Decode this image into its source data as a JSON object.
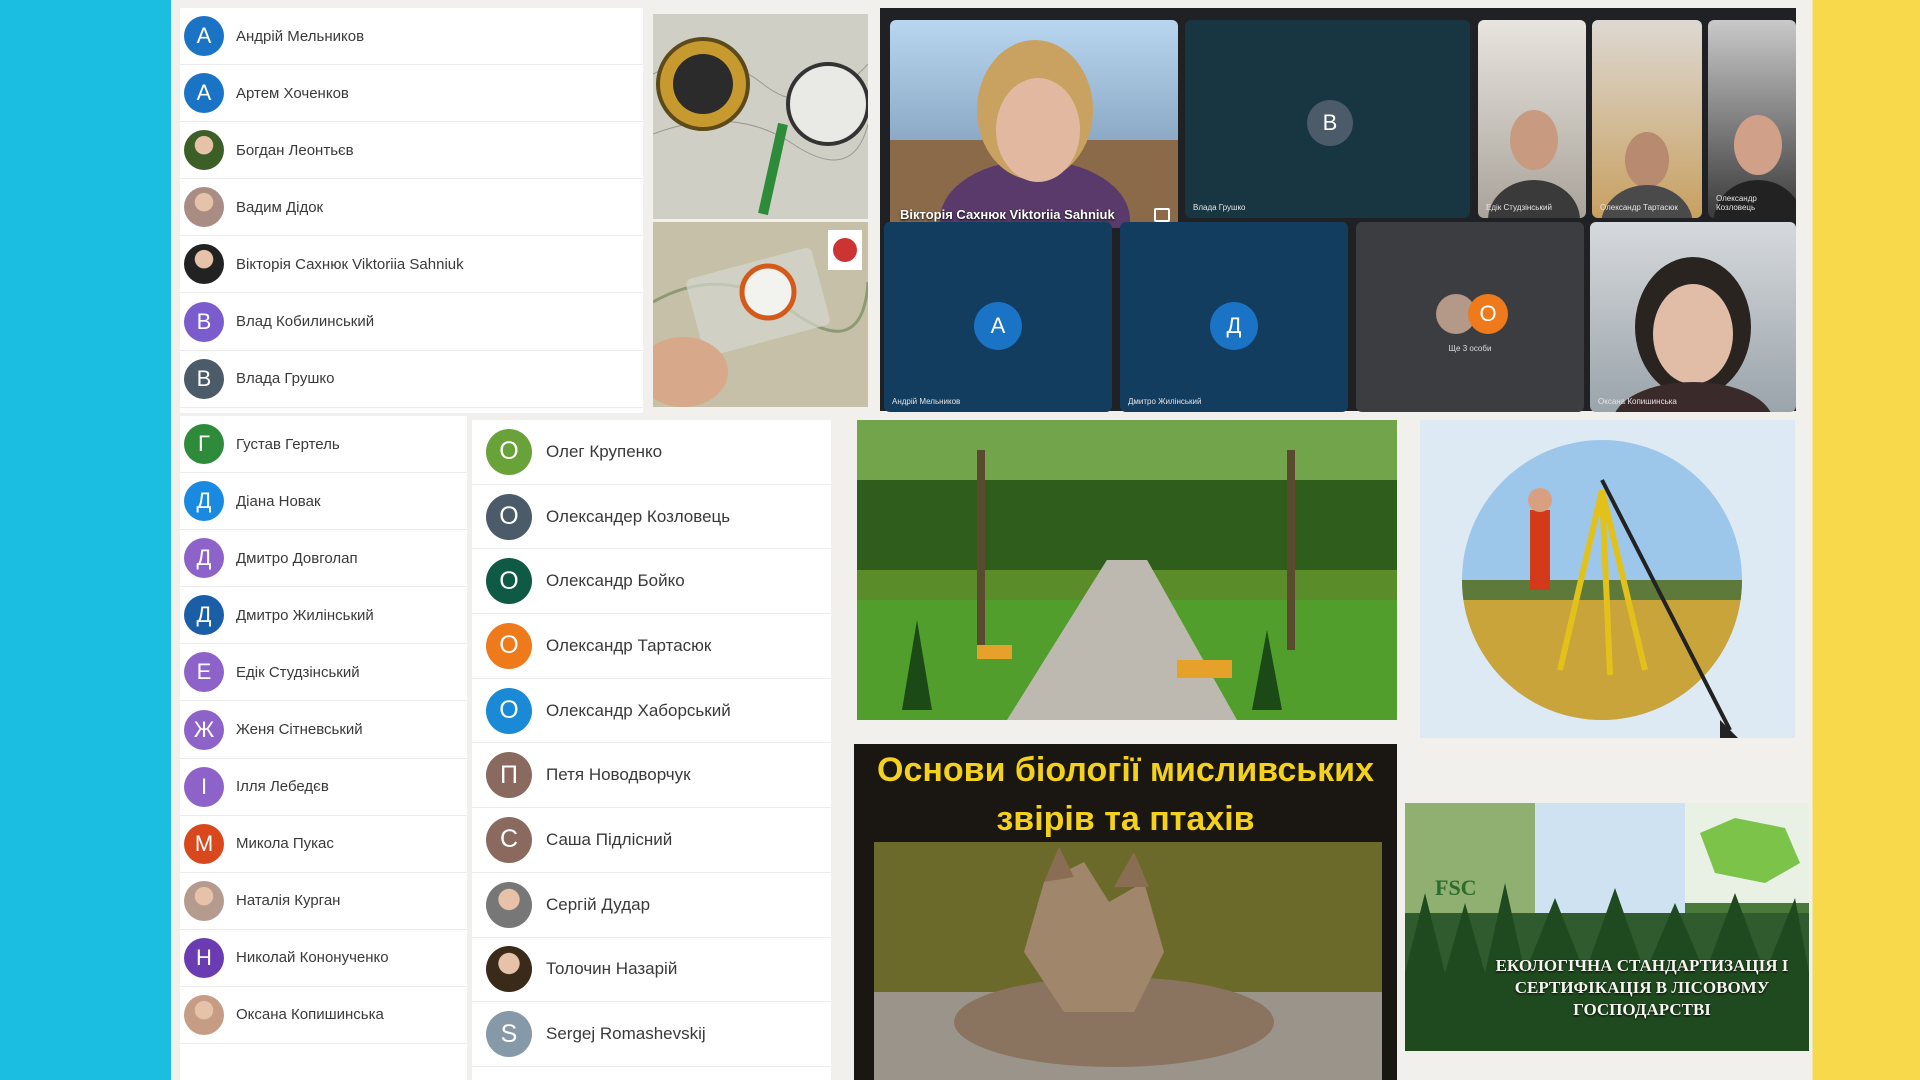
{
  "list_a": [
    {
      "name": "Андрій Мельников",
      "initial": "А",
      "color": "#1a73c4"
    },
    {
      "name": "Артем Хоченков",
      "initial": "А",
      "color": "#1a73c4"
    },
    {
      "name": "Богдан Леонтьєв",
      "initial": "",
      "color": "#3b5f26",
      "photo": true
    },
    {
      "name": "Вадим Дідок",
      "initial": "",
      "color": "#a98c83",
      "photo": true
    },
    {
      "name": "Вікторія Сахнюк Viktoriia Sahniuk",
      "initial": "",
      "color": "#222",
      "photo": true
    },
    {
      "name": "Влад Кобилинський",
      "initial": "В",
      "color": "#7a5ccc"
    },
    {
      "name": "Влада Грушко",
      "initial": "В",
      "color": "#4b5b6a"
    }
  ],
  "list_b": [
    {
      "name": "Густав Гертель",
      "initial": "Г",
      "color": "#2e8b3a"
    },
    {
      "name": "Діана Новак",
      "initial": "Д",
      "color": "#1a8ae0"
    },
    {
      "name": "Дмитро Довголап",
      "initial": "Д",
      "color": "#8e63c9"
    },
    {
      "name": "Дмитро Жилінський",
      "initial": "Д",
      "color": "#1a5ea8"
    },
    {
      "name": "Едік Студзінський",
      "initial": "Е",
      "color": "#8e63c9"
    },
    {
      "name": "Женя Сітневський",
      "initial": "Ж",
      "color": "#8e63c9"
    },
    {
      "name": "Ілля Лебедєв",
      "initial": "І",
      "color": "#8e63c9"
    },
    {
      "name": "Микола Пукас",
      "initial": "М",
      "color": "#d9481c"
    },
    {
      "name": "Наталія Курган",
      "initial": "",
      "color": "#b59a8e",
      "photo": true
    },
    {
      "name": "Николай Кононученко",
      "initial": "Н",
      "color": "#6b3bb2"
    },
    {
      "name": "Оксана Копишинська",
      "initial": "",
      "color": "#c69c84",
      "photo": true
    }
  ],
  "list_c": [
    {
      "name": "Олег Крупенко",
      "initial": "О",
      "color": "#6aa23a"
    },
    {
      "name": "Олександер Козловець",
      "initial": "О",
      "color": "#4b5b6a"
    },
    {
      "name": "Олександр Бойко",
      "initial": "О",
      "color": "#0f5a45"
    },
    {
      "name": "Олександр Тартасюк",
      "initial": "О",
      "color": "#ee7a1b"
    },
    {
      "name": "Олександр Хаборський",
      "initial": "О",
      "color": "#1a8ad6"
    },
    {
      "name": "Петя Новодворчук",
      "initial": "П",
      "color": "#8a6a5e"
    },
    {
      "name": "Саша Підлісний",
      "initial": "С",
      "color": "#8a6a5e"
    },
    {
      "name": "Сергій Дудар",
      "initial": "",
      "color": "#777",
      "photo": true
    },
    {
      "name": "Толочин Назарій",
      "initial": "",
      "color": "#3a2a1a",
      "photo": true
    },
    {
      "name": "Sergej Romashevskij",
      "initial": "S",
      "color": "#8699a8"
    }
  ],
  "video": {
    "main_name": "Вікторія Сахнюк Viktoriia Sahniuk",
    "tile_v_initial": "В",
    "tile_v_label": "Влада Грушко",
    "tile_e_label": "Едік Студзінський",
    "tile_t_label": "Олександр Тартасюк",
    "tile_k_label": "Олександр Козловець",
    "tile_a_initial": "А",
    "tile_a_label": "Андрій Мельников",
    "tile_d_initial": "Д",
    "tile_d_label": "Дмитро Жилінський",
    "tile_o_initial": "О",
    "tile_o_label": "Ще 3 особи",
    "tile_s_label": "Оксана Копишинська"
  },
  "course_banner": {
    "title": "Основи біології мисливських звірів та птахів"
  },
  "fsc_banner": {
    "logo_text": "FSC",
    "title": "ЕКОЛОГІЧНА СТАНДАРТИЗАЦІЯ І СЕРТИФІКАЦІЯ В ЛІСОВОМУ ГОСПОДАРСТВІ"
  },
  "colors": {
    "left_stripe": "#1bbde0",
    "right_stripe": "#f8d94c",
    "meet_bg": "#202124"
  }
}
